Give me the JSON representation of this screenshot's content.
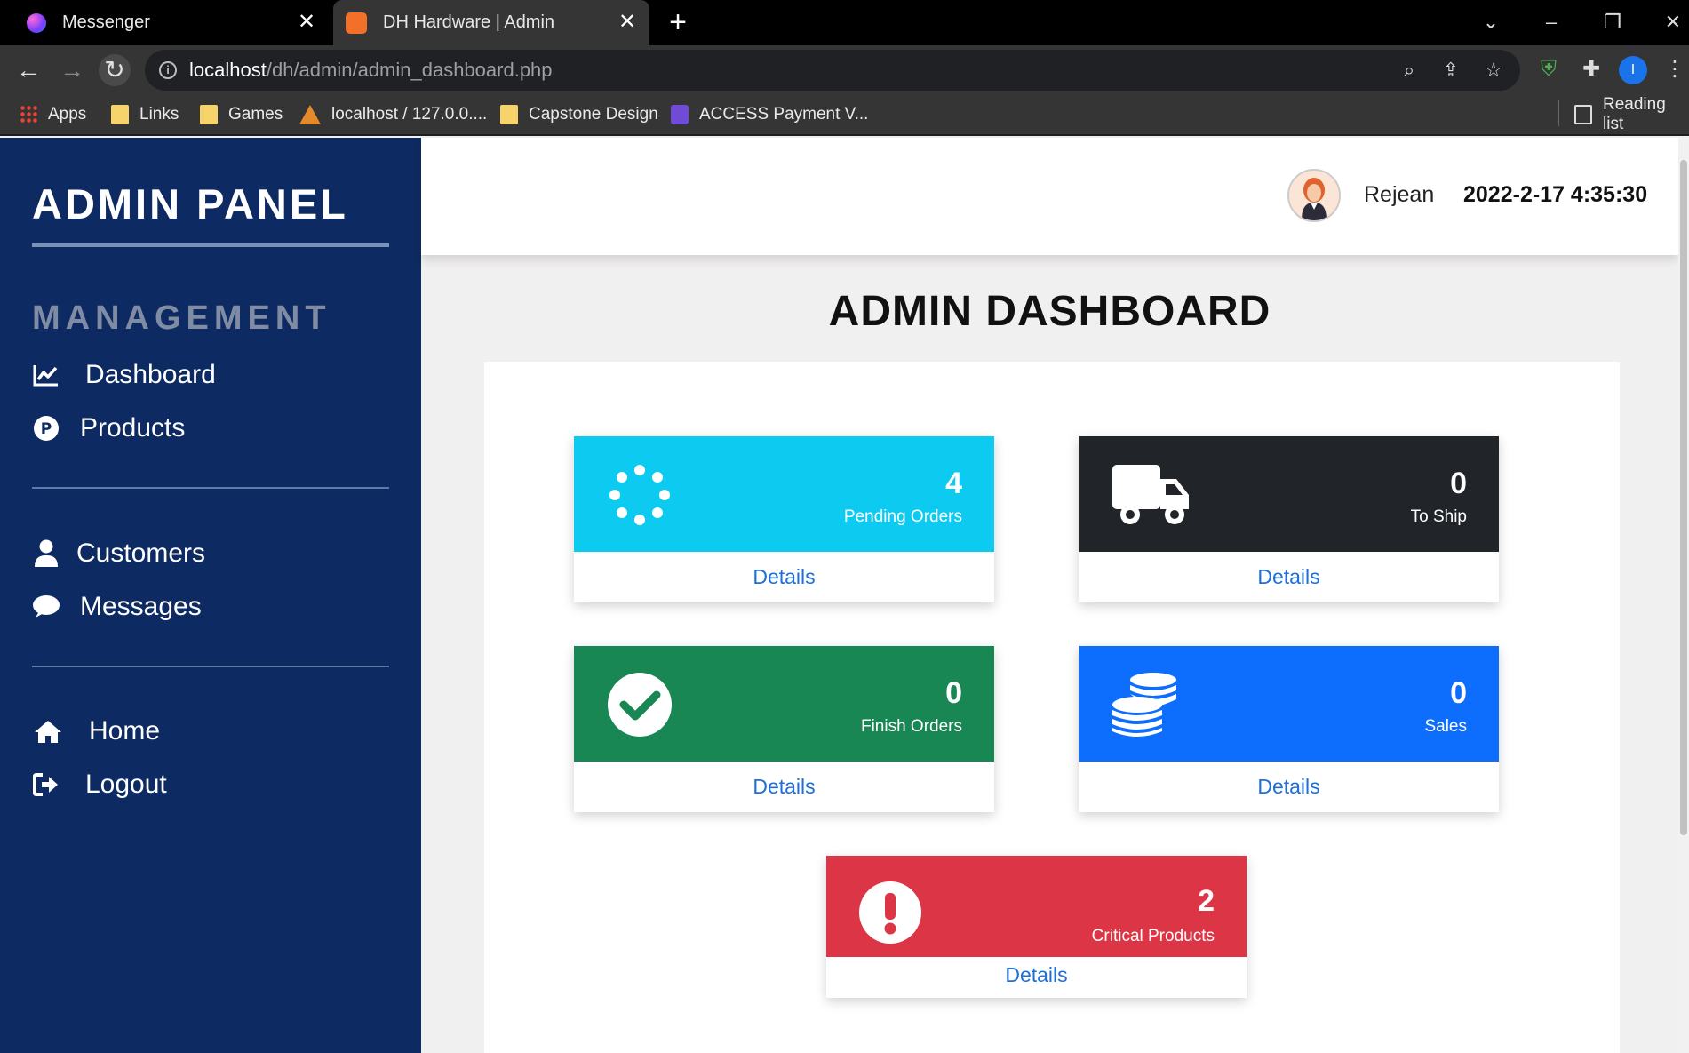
{
  "browser": {
    "tabs": [
      {
        "title": "Messenger"
      },
      {
        "title": "DH Hardware | Admin"
      }
    ],
    "url_host": "localhost",
    "url_path": "/dh/admin/admin_dashboard.php",
    "profile_initial": "I",
    "bookmarks": [
      {
        "label": "Apps"
      },
      {
        "label": "Links"
      },
      {
        "label": "Games"
      },
      {
        "label": "localhost / 127.0.0...."
      },
      {
        "label": "Capstone Design"
      },
      {
        "label": "ACCESS Payment V..."
      }
    ],
    "reading_list": "Reading list"
  },
  "sidebar": {
    "brand": "ADMIN PANEL",
    "section": "MANAGEMENT",
    "items": [
      {
        "label": "Dashboard"
      },
      {
        "label": "Products"
      },
      {
        "label": "Customers"
      },
      {
        "label": "Messages"
      },
      {
        "label": "Home"
      },
      {
        "label": "Logout"
      }
    ]
  },
  "header": {
    "username": "Rejean",
    "datetime": "2022-2-17 4:35:30"
  },
  "page_title": "ADMIN DASHBOARD",
  "cards": [
    {
      "count": "4",
      "label": "Pending Orders",
      "details": "Details",
      "color": "#0dcaf0"
    },
    {
      "count": "0",
      "label": "To Ship",
      "details": "Details",
      "color": "#212529"
    },
    {
      "count": "0",
      "label": "Finish Orders",
      "details": "Details",
      "color": "#198754"
    },
    {
      "count": "0",
      "label": "Sales",
      "details": "Details",
      "color": "#0d6efd"
    },
    {
      "count": "2",
      "label": "Critical Products",
      "details": "Details",
      "color": "#dc3545"
    }
  ]
}
